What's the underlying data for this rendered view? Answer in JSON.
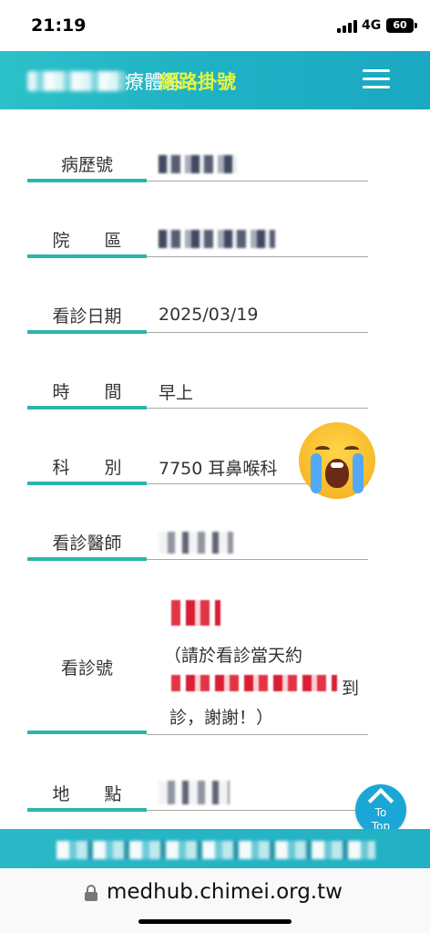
{
  "status_bar": {
    "time": "21:19",
    "network": "4G",
    "battery": "60"
  },
  "header": {
    "title_partial": "療體系",
    "title_accent": "網路掛號",
    "accent_color": "#e6f542",
    "bar_color": "#1fb2c4"
  },
  "form": {
    "rows": [
      {
        "label": "病歷號",
        "value": ""
      },
      {
        "label": "院　　區",
        "value": ""
      },
      {
        "label": "看診日期",
        "value": "2025/03/19"
      },
      {
        "label": "時　　間",
        "value": "早上"
      },
      {
        "label": "科　　別",
        "value": "7750 耳鼻喉科"
      },
      {
        "label": "看診醫師",
        "value": ""
      },
      {
        "label": "看診號",
        "value": ""
      },
      {
        "label": "地　　點",
        "value": ""
      }
    ],
    "queue_note_line1": "（請於看診當天約",
    "queue_note_line2_suffix": "到",
    "queue_note_line3": "診，謝謝！）"
  },
  "to_top": {
    "line1": "To",
    "line2": "Top"
  },
  "browser": {
    "url": "medhub.chimei.org.tw"
  },
  "icons": {
    "menu": "hamburger-menu-icon",
    "emoji": "loudly-crying-face-emoji",
    "scroll": "chevron-up-icon",
    "lock": "lock-icon"
  }
}
